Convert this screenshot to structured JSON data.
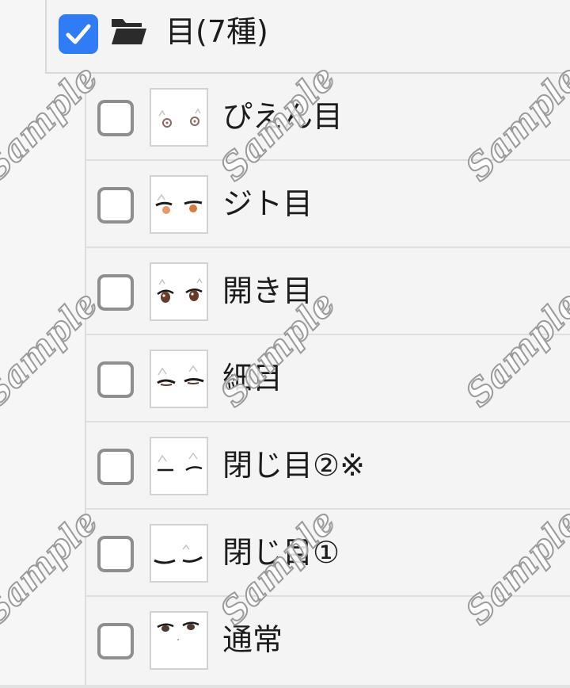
{
  "folder": {
    "checked": true,
    "label": "目(7種)",
    "accent_color": "#2f7df6",
    "icon": "folder-icon"
  },
  "layers": [
    {
      "label": "ぴえん目",
      "checked": false
    },
    {
      "label": "ジト目",
      "checked": false
    },
    {
      "label": "開き目",
      "checked": false
    },
    {
      "label": "細目",
      "checked": false
    },
    {
      "label": "閉じ目②※",
      "checked": false
    },
    {
      "label": "閉じ目①",
      "checked": false
    },
    {
      "label": "通常",
      "checked": false
    }
  ],
  "watermark": "Sample"
}
